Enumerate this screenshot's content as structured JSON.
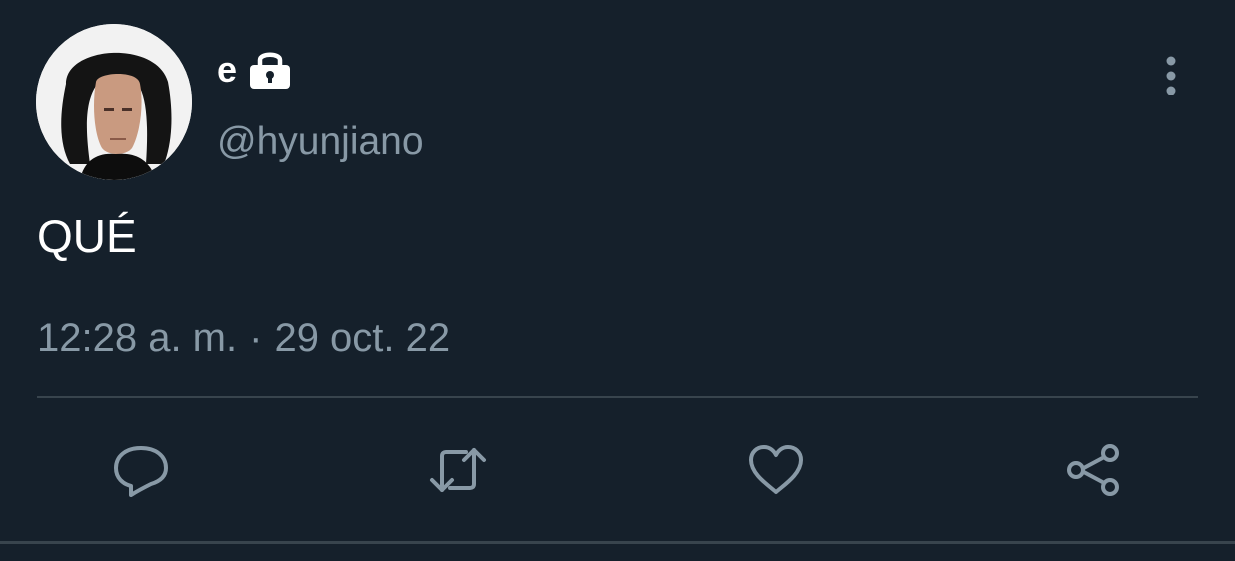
{
  "author": {
    "display_name": "e",
    "handle": "@hyunjiano",
    "avatar_icon": "profile-photo",
    "lock_icon": "lock-icon",
    "protected": true
  },
  "tweet": {
    "text": "QUÉ",
    "time": "12:28 a. m.",
    "separator": "·",
    "date": "29 oct. 22"
  },
  "actions": [
    {
      "name": "reply",
      "icon": "reply-icon"
    },
    {
      "name": "retweet",
      "icon": "retweet-icon"
    },
    {
      "name": "like",
      "icon": "heart-icon"
    },
    {
      "name": "share",
      "icon": "share-icon"
    }
  ],
  "menu": {
    "icon": "more-vertical-icon"
  },
  "colors": {
    "background": "#15202b",
    "primary_text": "#ffffff",
    "secondary_text": "#8899a6",
    "divider": "#38444d"
  }
}
